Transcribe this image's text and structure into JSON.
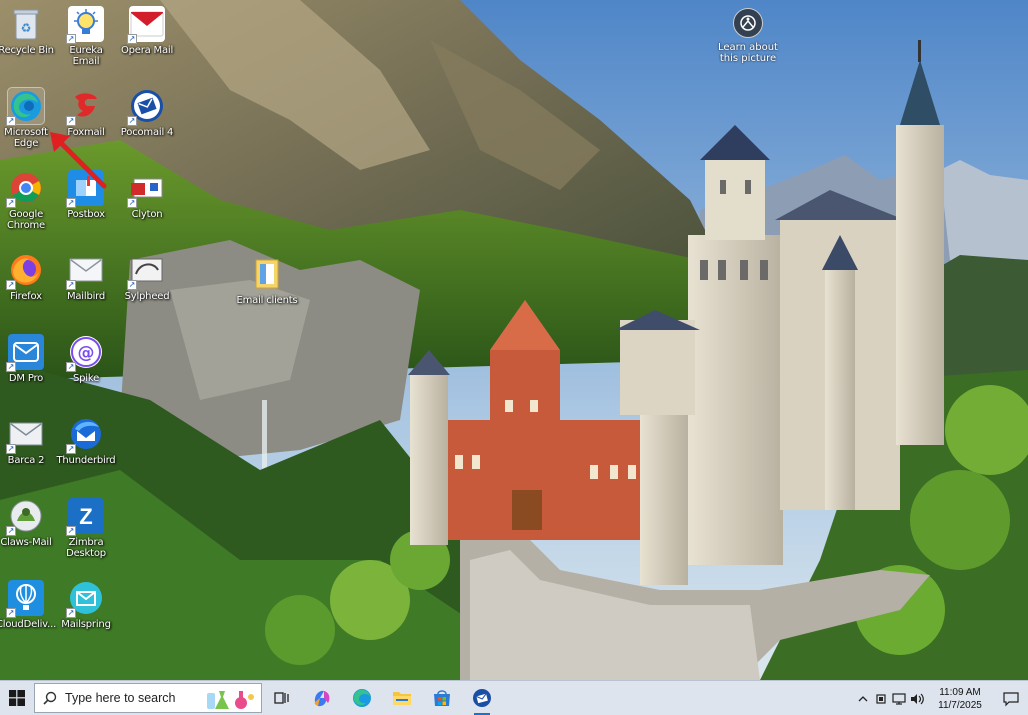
{
  "desktop": {
    "icons": [
      {
        "label": "Recycle Bin",
        "icon": "recycle-bin-icon"
      },
      {
        "label": "Eureka Email",
        "icon": "eureka-email-icon"
      },
      {
        "label": "Opera Mail",
        "icon": "opera-mail-icon"
      },
      {
        "label": "Microsoft Edge",
        "icon": "edge-icon"
      },
      {
        "label": "Foxmail",
        "icon": "foxmail-icon"
      },
      {
        "label": "Pocomail 4",
        "icon": "pocomail-icon"
      },
      {
        "label": "Google Chrome",
        "icon": "chrome-icon"
      },
      {
        "label": "Postbox",
        "icon": "postbox-icon"
      },
      {
        "label": "Clyton",
        "icon": "clyton-icon"
      },
      {
        "label": "Firefox",
        "icon": "firefox-icon"
      },
      {
        "label": "Mailbird",
        "icon": "mailbird-icon"
      },
      {
        "label": "Sylpheed",
        "icon": "sylpheed-icon"
      },
      {
        "label": "Email clients",
        "icon": "folder-icon"
      },
      {
        "label": "DM Pro",
        "icon": "dm-pro-icon"
      },
      {
        "label": "Spike",
        "icon": "spike-icon"
      },
      {
        "label": "Barca 2",
        "icon": "barca-icon"
      },
      {
        "label": "Thunderbird",
        "icon": "thunderbird-icon"
      },
      {
        "label": "Claws-Mail",
        "icon": "claws-mail-icon"
      },
      {
        "label": "Zimbra Desktop",
        "icon": "zimbra-icon"
      },
      {
        "label": "CloudDeliv...",
        "icon": "clouddeliver-icon"
      },
      {
        "label": "Mailspring",
        "icon": "mailspring-icon"
      }
    ],
    "learn_picture": {
      "label": "Learn about this picture",
      "icon": "camera-lens-icon"
    }
  },
  "taskbar": {
    "search_placeholder": "Type here to search",
    "pinned": [
      {
        "name": "task-view",
        "icon": "task-view-icon"
      },
      {
        "name": "copilot",
        "icon": "copilot-icon"
      },
      {
        "name": "edge",
        "icon": "edge-icon"
      },
      {
        "name": "file-explorer",
        "icon": "folder-icon"
      },
      {
        "name": "microsoft-store",
        "icon": "store-icon"
      },
      {
        "name": "pocomail",
        "icon": "pocomail-icon"
      }
    ],
    "clock": {
      "time": "11:09 AM",
      "date": "11/7/2025"
    }
  },
  "colors": {
    "taskbar_bg": "#dde4ed",
    "accent": "#1f6fd0",
    "arrow": "#e02020"
  }
}
